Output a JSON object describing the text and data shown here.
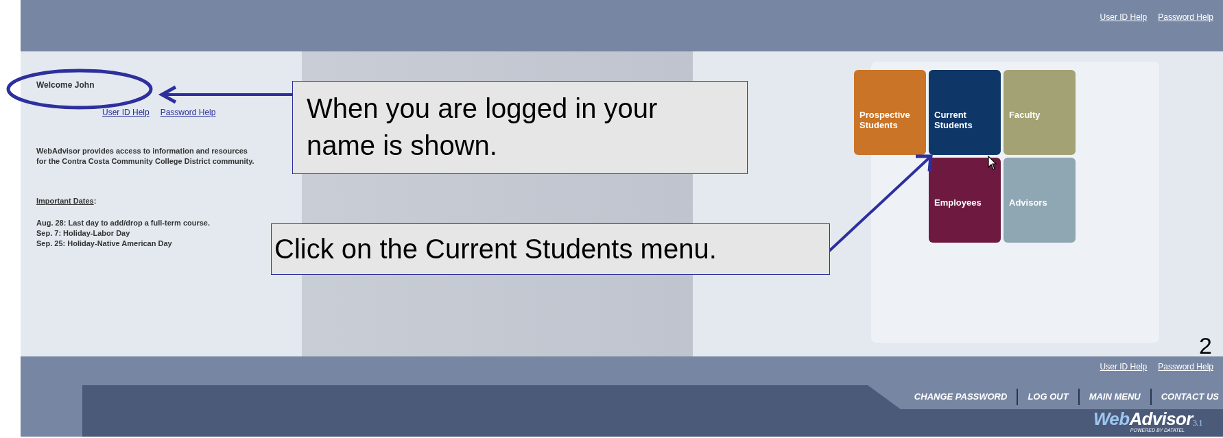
{
  "header_links": [
    "User ID Help",
    "Password Help"
  ],
  "welcome": "Welcome John",
  "welcome_links": [
    "User ID Help",
    "Password Help"
  ],
  "intro": "WebAdvisor provides access to information and resources for the Contra Costa Community College District community.",
  "important_dates": {
    "label": "Important Dates",
    "suffix": ":"
  },
  "dates": [
    "Aug. 28: Last day to add/drop a full-term course.",
    "Sep. 7: Holiday-Labor Day",
    "Sep. 25: Holiday-Native American Day"
  ],
  "tiles": [
    {
      "label": "Prospective Students",
      "color": "#c97426"
    },
    {
      "label": "Current Students",
      "color": "#0e3768"
    },
    {
      "label": "Faculty",
      "color": "#a3a274"
    },
    {
      "label": "Employees",
      "color": "#6e1a40"
    },
    {
      "label": "Advisors",
      "color": "#8ea7b3"
    }
  ],
  "footer_links": [
    "User ID Help",
    "Password Help"
  ],
  "nav": [
    "CHANGE PASSWORD",
    "LOG OUT",
    "MAIN MENU",
    "CONTACT US"
  ],
  "logo": {
    "first": "Web",
    "second": "Advisor",
    "version": "3.1",
    "tagline": "POWERED BY DATATEL"
  },
  "callouts": [
    "When you are logged in your name is shown.",
    "Click on the Current Students menu."
  ],
  "slide_number": "2"
}
